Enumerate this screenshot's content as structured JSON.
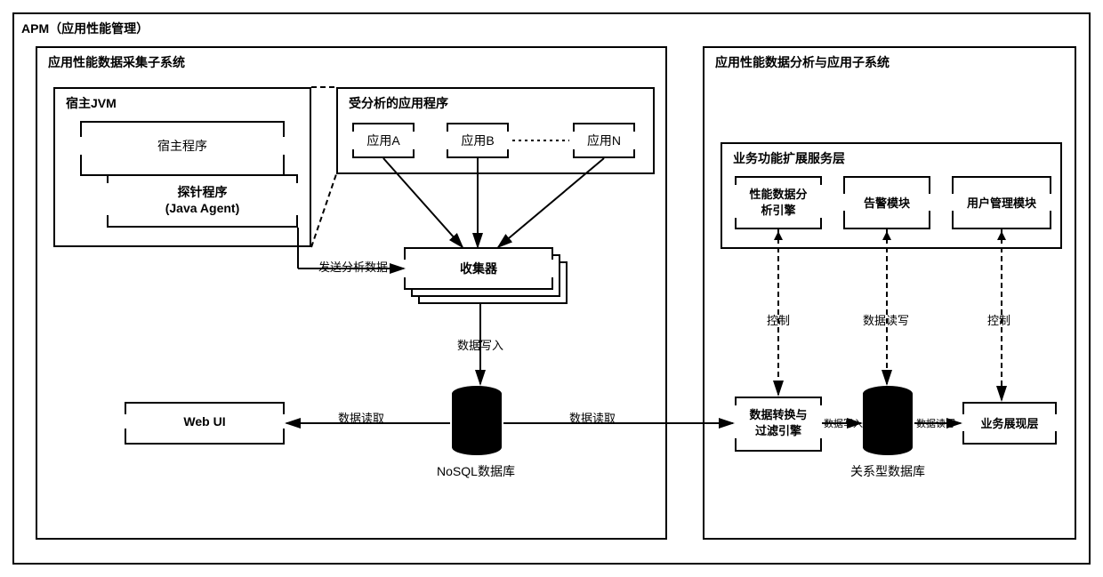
{
  "outer": {
    "title": "APM（应用性能管理）"
  },
  "left": {
    "title": "应用性能数据采集子系统",
    "jvm": {
      "title": "宿主JVM",
      "host_prog": "宿主程序",
      "agent_line1": "探针程序",
      "agent_line2": "(Java Agent)"
    },
    "apps": {
      "title": "受分析的应用程序",
      "a": "应用A",
      "b": "应用B",
      "n": "应用N"
    },
    "collector": "收集器",
    "webui": "Web UI",
    "nosql": "NoSQL数据库",
    "edge_send": "发送分析数据",
    "edge_write": "数据写入",
    "edge_read_left": "数据读取",
    "edge_read_right": "数据读取"
  },
  "right": {
    "title": "应用性能数据分析与应用子系统",
    "service_layer": "业务功能扩展服务层",
    "perf_engine_l1": "性能数据分",
    "perf_engine_l2": "析引擎",
    "alarm": "告警模块",
    "user_mgmt": "用户管理模块",
    "data_trans_l1": "数据转换与",
    "data_trans_l2": "过滤引擎",
    "biz_view": "业务展现层",
    "rel_db": "关系型数据库",
    "edge_control": "控制",
    "edge_rw": "数据读写",
    "edge_ctrl2": "控制",
    "edge_dw_left": "数据写入",
    "edge_dw_right": "数据读写"
  }
}
